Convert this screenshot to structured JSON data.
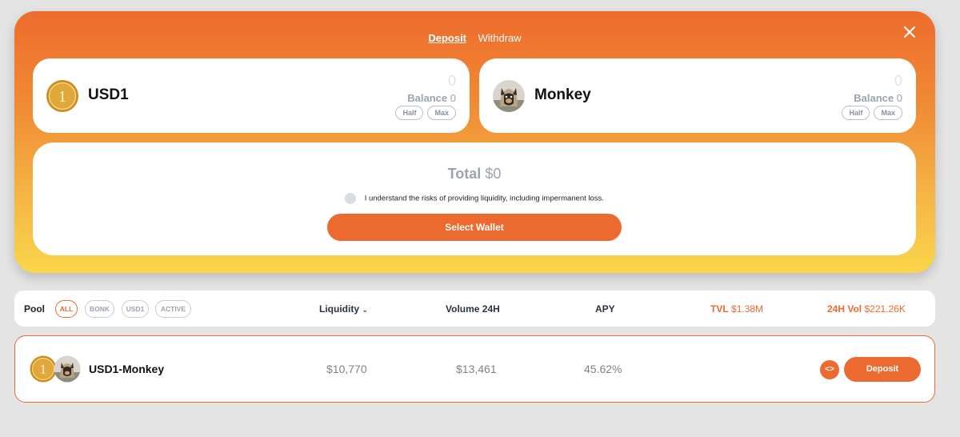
{
  "modal": {
    "tabs": [
      {
        "label": "Deposit",
        "active": true
      },
      {
        "label": "Withdraw",
        "active": false
      }
    ],
    "close_icon": "close-icon"
  },
  "token_a": {
    "name": "USD1",
    "amount": "0",
    "balance_label": "Balance",
    "balance_value": "0",
    "half_label": "Half",
    "max_label": "Max",
    "icon": "usd1-coin-icon"
  },
  "token_b": {
    "name": "Monkey",
    "amount": "0",
    "balance_label": "Balance",
    "balance_value": "0",
    "half_label": "Half",
    "max_label": "Max",
    "icon": "monkey-avatar-icon"
  },
  "total": {
    "label": "Total",
    "value": "$0",
    "agreement": "I understand the risks of providing liquidity, including impermanent loss.",
    "select_wallet_label": "Select Wallet"
  },
  "pool_bar": {
    "pool_label": "Pool",
    "filters": [
      "ALL",
      "BONK",
      "USD1",
      "ACTIVE"
    ],
    "active_filter": "ALL",
    "liquidity_label": "Liquidity",
    "volume_label": "Volume 24H",
    "apy_label": "APY",
    "tvl_label": "TVL",
    "tvl_value": "$1.38M",
    "vol_label": "24H Vol",
    "vol_value": "$221.26K"
  },
  "pool_row": {
    "name": "USD1-Monkey",
    "liquidity": "$10,770",
    "volume": "$13,461",
    "apy": "45.62%",
    "deposit_label": "Deposit"
  },
  "colors": {
    "accent": "#ec6930",
    "gradient_top": "#ee6b2d",
    "gradient_bottom": "#fad64b"
  }
}
